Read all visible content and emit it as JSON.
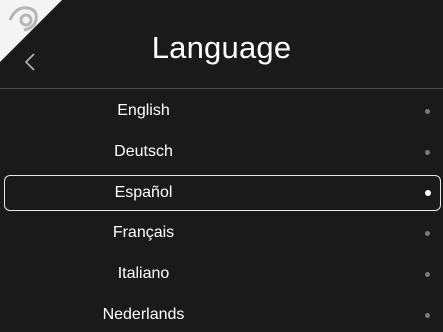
{
  "header": {
    "title": "Language",
    "back_icon": "chevron-left-icon"
  },
  "languages": [
    {
      "label": "English",
      "selected": false
    },
    {
      "label": "Deutsch",
      "selected": false
    },
    {
      "label": "Español",
      "selected": true
    },
    {
      "label": "Français",
      "selected": false
    },
    {
      "label": "Italiano",
      "selected": false
    },
    {
      "label": "Nederlands",
      "selected": false
    }
  ],
  "colors": {
    "background": "#1a1a1a",
    "text": "#ffffff",
    "divider": "#4a4a4a",
    "dot_inactive": "#7a7a7a",
    "dot_active": "#ffffff",
    "selection_border": "#e6e6e6"
  }
}
